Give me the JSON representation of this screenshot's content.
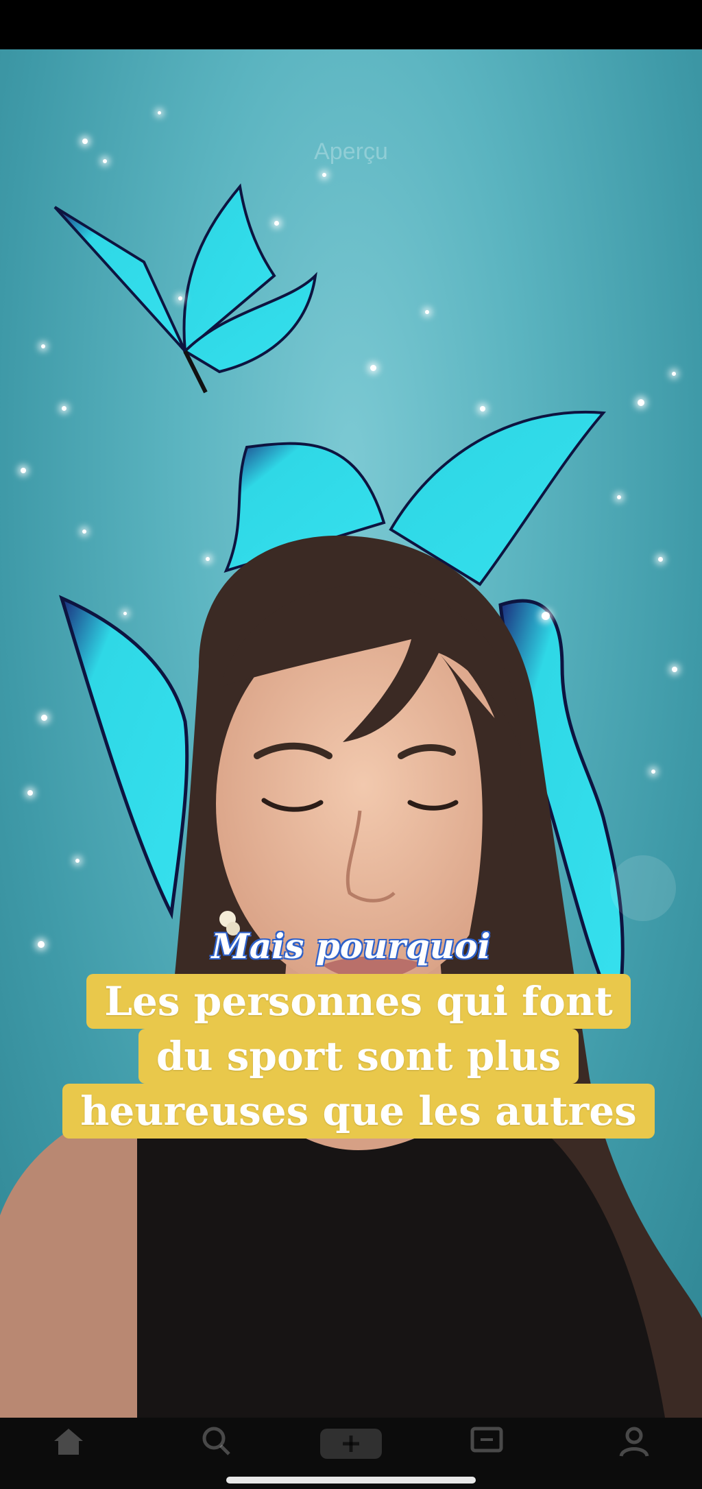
{
  "overlay": {
    "preview_label": "Aperçu"
  },
  "caption": {
    "kicker": "Mais pourquoi",
    "lines": [
      "Les personnes qui font",
      "du sport sont plus",
      "heureuses que les autres"
    ]
  },
  "colors": {
    "caption_background": "#e9c84b",
    "kicker_outline": "#2d5fc7",
    "background_teal": "#5bb4c0"
  }
}
